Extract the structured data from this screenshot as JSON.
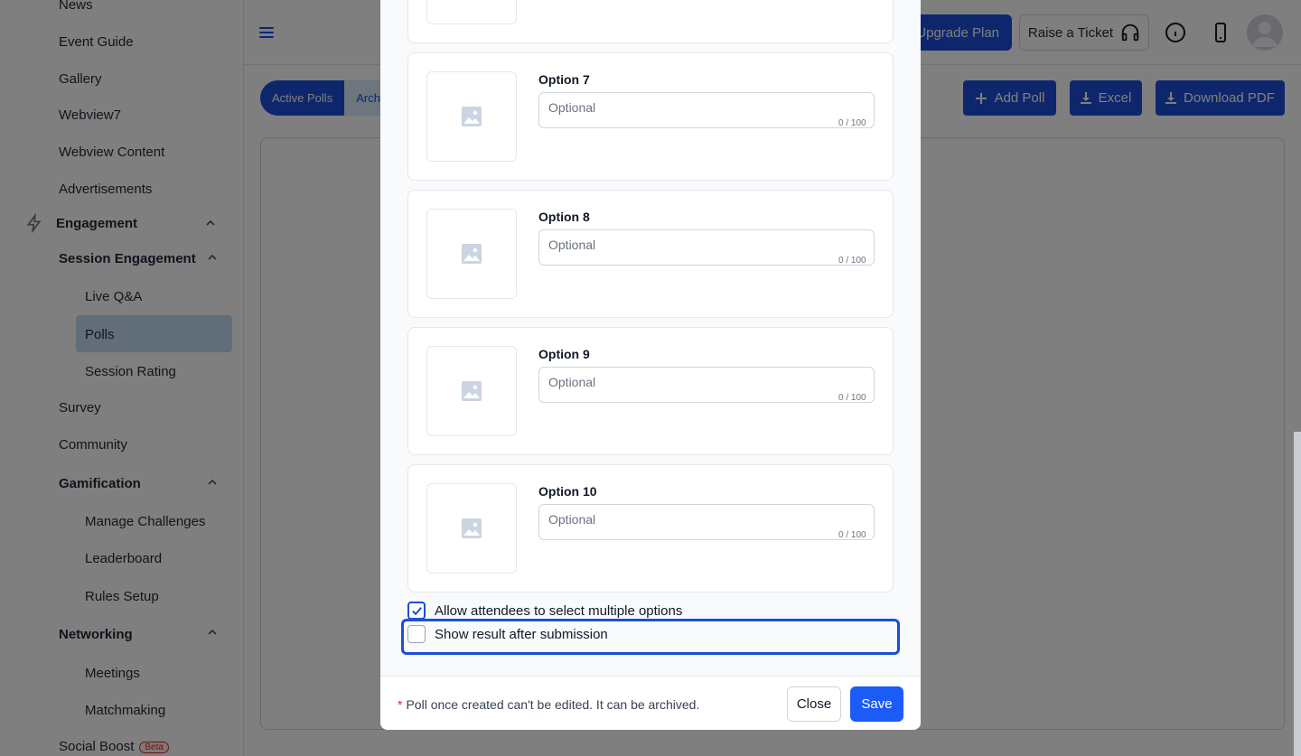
{
  "sidebar": {
    "items": [
      {
        "label": "News"
      },
      {
        "label": "Event Guide"
      },
      {
        "label": "Gallery"
      },
      {
        "label": "Webview7"
      },
      {
        "label": "Webview Content"
      },
      {
        "label": "Advertisements"
      }
    ],
    "engagement_label": "Engagement",
    "session_engagement_label": "Session Engagement",
    "session_items": [
      {
        "label": "Live Q&A"
      },
      {
        "label": "Polls"
      },
      {
        "label": "Session Rating"
      }
    ],
    "survey_label": "Survey",
    "community_label": "Community",
    "gamification_label": "Gamification",
    "gamification_items": [
      {
        "label": "Manage Challenges"
      },
      {
        "label": "Leaderboard"
      },
      {
        "label": "Rules Setup"
      }
    ],
    "networking_label": "Networking",
    "networking_items": [
      {
        "label": "Meetings"
      },
      {
        "label": "Matchmaking"
      }
    ],
    "social_boost_label": "Social Boost",
    "beta_label": "Beta"
  },
  "header": {
    "upgrade_label": "Upgrade Plan",
    "ticket_label": "Raise a Ticket"
  },
  "toolbar": {
    "tab_active_label": "Active Polls",
    "tab_archived_label": "Archi",
    "add_poll_label": "Add Poll",
    "excel_label": "Excel",
    "download_pdf_label": "Download PDF"
  },
  "modal": {
    "options": [
      {
        "label": "Option 7",
        "placeholder": "Optional",
        "counter": "0 / 100"
      },
      {
        "label": "Option 8",
        "placeholder": "Optional",
        "counter": "0 / 100"
      },
      {
        "label": "Option 9",
        "placeholder": "Optional",
        "counter": "0 / 100"
      },
      {
        "label": "Option 10",
        "placeholder": "Optional",
        "counter": "0 / 100"
      }
    ],
    "allow_multiple_label": "Allow attendees to select multiple options",
    "show_result_label": "Show result after submission",
    "footer_star": "*",
    "footer_note": "Poll once created can't be edited. It can be archived.",
    "close_label": "Close",
    "save_label": "Save"
  },
  "colors": {
    "primary": "#1d4ed8",
    "save": "#1a5cf5",
    "active_nav": "#c3daf3",
    "required": "#dc2626"
  }
}
